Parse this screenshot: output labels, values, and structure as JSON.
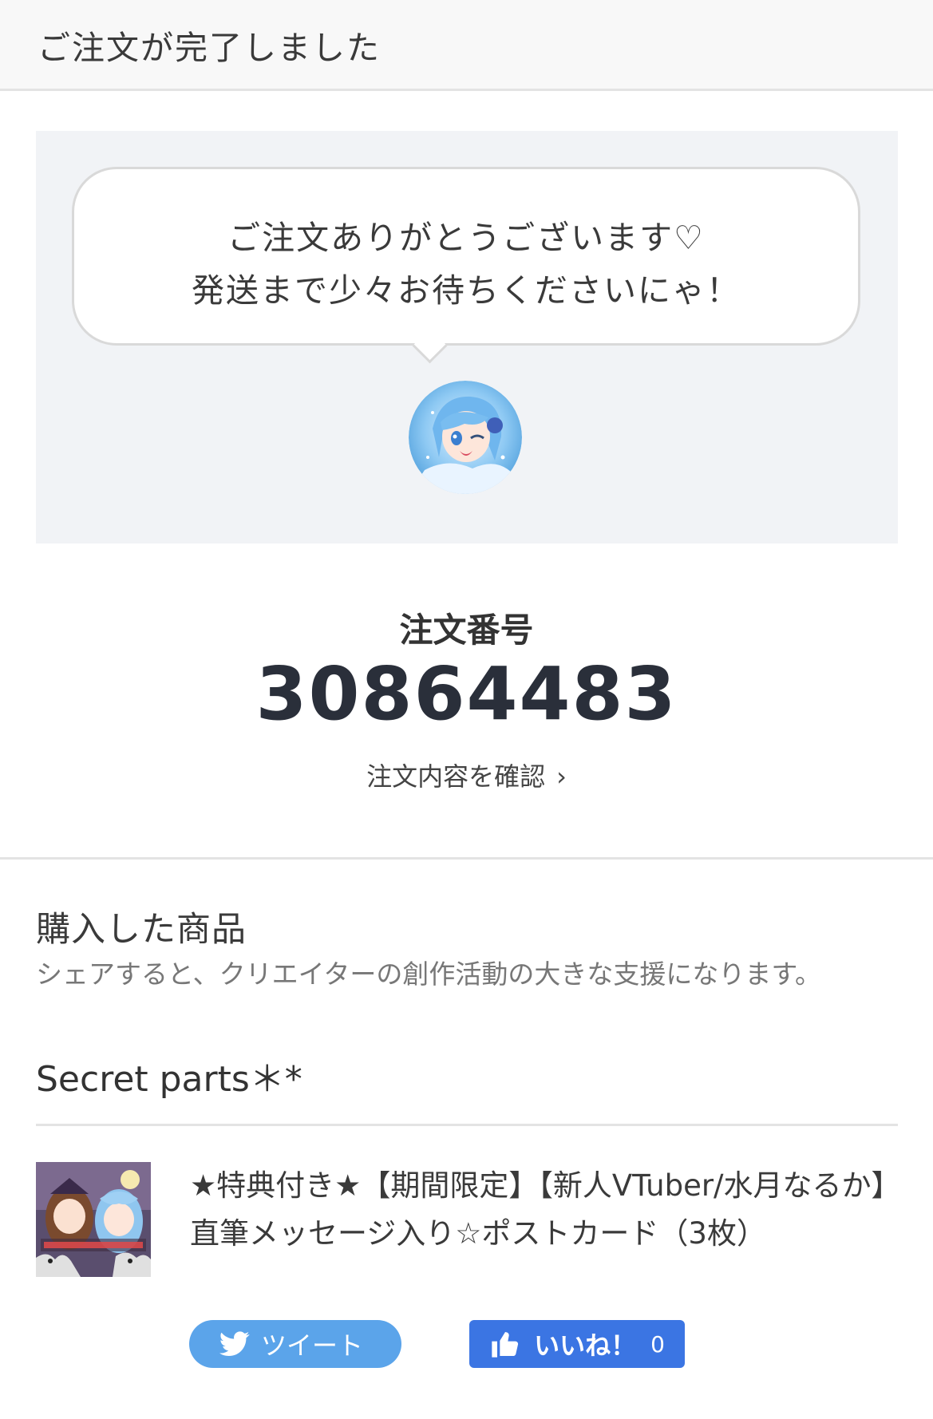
{
  "header": {
    "title": "ご注文が完了しました"
  },
  "message": {
    "line1": "ご注文ありがとうございます♡",
    "line2": "発送まで少々お待ちくださいにゃ！",
    "avatar_icon": "creator-avatar-icon"
  },
  "order": {
    "label": "注文番号",
    "number": "30864483",
    "details_link": "注文内容を確認",
    "details_chevron": "›"
  },
  "purchased": {
    "title": "購入した商品",
    "subtitle": "シェアすると、クリエイターの創作活動の大きな支援になります。",
    "shop_name": "Secret parts＊*",
    "items": [
      {
        "thumbnail_icon": "product-thumbnail-image",
        "title": "★特典付き★【期間限定】【新人VTuber/水月なるか】直筆メッセージ入り☆ポストカード（3枚）",
        "tweet_label": "ツイート",
        "like_label": "いいね！",
        "like_count": "0"
      }
    ]
  },
  "colors": {
    "header_bg": "#f8f8f8",
    "panel_bg": "#f1f3f6",
    "tweet_blue": "#5ba4ea",
    "like_blue": "#3b75e3",
    "order_number": "#2a2f3a"
  }
}
